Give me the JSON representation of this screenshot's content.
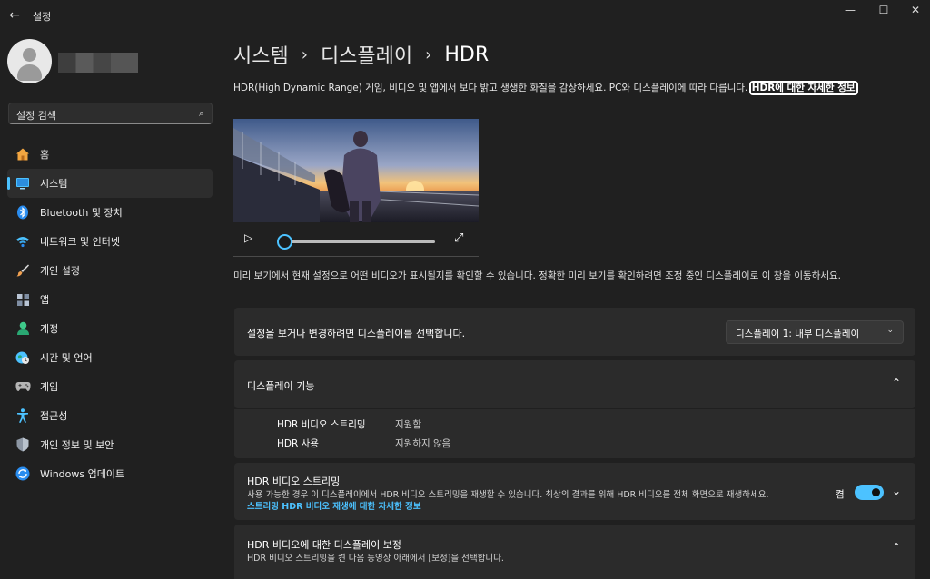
{
  "window": {
    "title": "설정",
    "back_icon": "back-arrow-icon",
    "minimize_glyph": "—",
    "maximize_glyph": "☐",
    "close_glyph": "✕"
  },
  "search": {
    "placeholder": "설정 검색",
    "icon": "search-icon"
  },
  "sidebar": {
    "items": [
      {
        "label": "홈",
        "icon": "home-icon",
        "color": "#f5b84a"
      },
      {
        "label": "시스템",
        "icon": "system-icon",
        "color": "#4cc2ff",
        "active": true
      },
      {
        "label": "Bluetooth 및 장치",
        "icon": "bluetooth-icon",
        "color": "#2a8df0"
      },
      {
        "label": "네트워크 및 인터넷",
        "icon": "wifi-icon",
        "color": "#4cc2ff"
      },
      {
        "label": "개인 설정",
        "icon": "brush-icon",
        "color": "#f0a050"
      },
      {
        "label": "앱",
        "icon": "apps-icon",
        "color": "#a9b6c8"
      },
      {
        "label": "계정",
        "icon": "account-icon",
        "color": "#3ec98a"
      },
      {
        "label": "시간 및 언어",
        "icon": "globe-clock-icon",
        "color": "#4cc2ff"
      },
      {
        "label": "게임",
        "icon": "gamepad-icon",
        "color": "#b0b0b0"
      },
      {
        "label": "접근성",
        "icon": "accessibility-icon",
        "color": "#4cc2ff"
      },
      {
        "label": "개인 정보 및 보안",
        "icon": "shield-icon",
        "color": "#9aa4b0"
      },
      {
        "label": "Windows 업데이트",
        "icon": "update-icon",
        "color": "#2a8df0"
      }
    ]
  },
  "breadcrumb": {
    "part1": "시스템",
    "part2": "디스플레이",
    "part3": "HDR",
    "sep": "›"
  },
  "intro": {
    "text": "HDR(High Dynamic Range) 게임, 비디오 및 앱에서 보다 밝고 생생한 화질을 감상하세요. PC와 디스플레이에 따라 다릅니다.",
    "link": "HDR에 대한 자세한 정보"
  },
  "player": {
    "play_icon": "play-icon",
    "fullscreen_icon": "fullscreen-icon",
    "progress": 0
  },
  "preview_note": "미리 보기에서 현재 설정으로 어떤 비디오가 표시될지를 확인할 수 있습니다. 정확한 미리 보기를 확인하려면 조정 중인 디스플레이로 이 창을 이동하세요.",
  "display_select": {
    "label": "설정을 보거나 변경하려면 디스플레이를 선택합니다.",
    "value": "디스플레이 1: 내부 디스플레이"
  },
  "capabilities": {
    "title": "디스플레이 기능",
    "rows": [
      {
        "name": "HDR 비디오 스트리밍",
        "value": "지원함"
      },
      {
        "name": "HDR 사용",
        "value": "지원하지 않음"
      }
    ]
  },
  "streaming": {
    "title": "HDR 비디오 스트리밍",
    "desc": "사용 가능한 경우 이 디스플레이에서 HDR 비디오 스트리밍을 재생할 수 있습니다. 최상의 결과를 위해 HDR 비디오를 전체 화면으로 재생하세요.",
    "link": "스트리밍 HDR 비디오 재생에 대한 자세한 정보",
    "toggle_label": "켬",
    "toggle_on": true
  },
  "calibration": {
    "title": "HDR 비디오에 대한 디스플레이 보정",
    "desc": "HDR 비디오 스트리밍을 켠 다음 동영상 아래에서 [보정]을 선택합니다."
  }
}
